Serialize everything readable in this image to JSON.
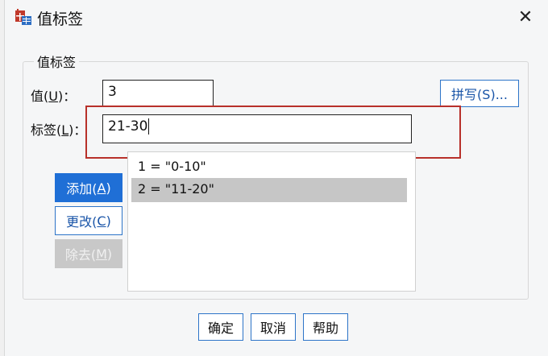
{
  "window": {
    "title": "值标签",
    "close_glyph": "✕"
  },
  "group": {
    "legend": "值标签"
  },
  "value_field": {
    "label_prefix": "值(",
    "label_hotkey": "U",
    "label_suffix": ")：",
    "value": "3"
  },
  "label_field": {
    "label_prefix": "标签(",
    "label_hotkey": "L",
    "label_suffix": ")：",
    "value": "21-30"
  },
  "buttons": {
    "spell_check": "拼写(S)...",
    "add_prefix": "添加(",
    "add_hotkey": "A",
    "add_suffix": ")",
    "change_prefix": "更改(",
    "change_hotkey": "C",
    "change_suffix": ")",
    "remove_prefix": "除去(",
    "remove_hotkey": "M",
    "remove_suffix": ")",
    "ok": "确定",
    "cancel": "取消",
    "help": "帮助"
  },
  "list": {
    "items": [
      {
        "text": "1 = \"0-10\"",
        "selected": false
      },
      {
        "text": "2 = \"11-20\"",
        "selected": true
      }
    ]
  },
  "colors": {
    "highlight_box": "#b8302a",
    "accent": "#1f6fd6",
    "selected_row": "#c6c6c6"
  },
  "icons": {
    "app": "table-value-label-icon",
    "close": "close-icon"
  }
}
